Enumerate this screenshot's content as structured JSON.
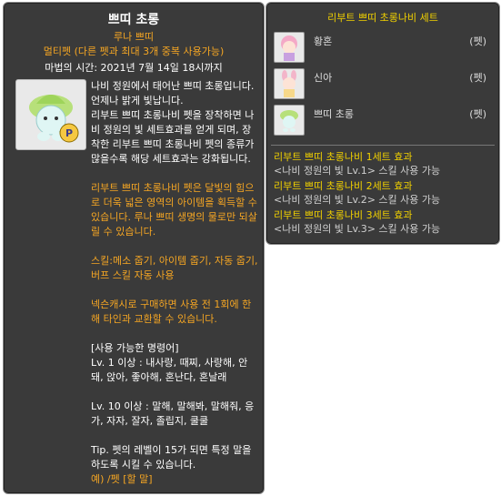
{
  "item": {
    "name": "쁘띠 초롱",
    "category": "루나 쁘띠",
    "multipet": "멀티펫 (다른 펫과 최대 3개 중복 사용가능)",
    "magic_time": "마법의 시간: 2021년 7월 14일 18시까지",
    "desc": "나비 정원에서 태어난 쁘띠 초롱입니다. 언제나 밝게 빛납니다.\n리부트 쁘띠 초롱나비 펫을 장착하면 나비 정원의 빛 세트효과를 얻게 되며, 장착한 리부트 쁘띠 초롱나비 펫의 종류가 많을수록 해당 세트효과는 강화됩니다.",
    "body_orange": "리부트 쁘띠 초롱나비 펫은 달빛의 힘으로 더욱 넓은 영역의 아이템을 획득할 수 있습니다. 루나 쁘띠 생명의 물로만 되살릴 수 있습니다.",
    "skills": "스킬:메소 줍기, 아이템 줍기, 자동 줍기, 버프 스킬 자동 사용",
    "trade": "넥슨캐시로 구매하면 사용 전 1회에 한해 타인과 교환할 수 있습니다.",
    "commands_header": "[사용 가능한 명령어]",
    "commands_lv1": "Lv. 1 이상 : 내사랑, 때찌, 사랑해, 안돼, 앉아, 좋아해, 혼난다, 혼날래",
    "commands_lv10": "Lv. 10 이상 : 말해, 말해봐, 말해줘, 응가, 자자, 잘자, 졸립지, 쿨쿨",
    "tip": "Tip. 펫의 레벨이 15가 되면 특정 말을 하도록 시킬 수 있습니다.",
    "example": "예) /펫 [할 말]"
  },
  "set": {
    "title": "리부트 쁘띠 초롱나비 세트",
    "pets": [
      {
        "name": "황혼",
        "tag": "(펫)",
        "icon": "pink-hair-pet-icon"
      },
      {
        "name": "신아",
        "tag": "(펫)",
        "icon": "bunny-girl-pet-icon"
      },
      {
        "name": "쁘띠 초롱",
        "tag": "(펫)",
        "icon": "green-sprout-pet-icon"
      }
    ],
    "effects": [
      {
        "title": "리부트 쁘띠 초롱나비 1세트 효과",
        "desc": "<나비 정원의 빛 Lv.1> 스킬 사용 가능"
      },
      {
        "title": "리부트 쁘띠 초롱나비 2세트 효과",
        "desc": "<나비 정원의 빛 Lv.2> 스킬 사용 가능"
      },
      {
        "title": "리부트 쁘띠 초롱나비 3세트 효과",
        "desc": "<나비 정원의 빛 Lv.3> 스킬 사용 가능"
      }
    ]
  },
  "colors": {
    "accent": "#f5a623",
    "set_yellow": "#f0d000",
    "panel": "#3a3a3a"
  }
}
